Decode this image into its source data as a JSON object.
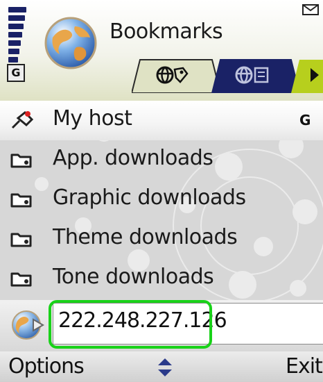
{
  "header": {
    "title": "Bookmarks",
    "gprs_indicator": "G",
    "signal_icon": "signal-strength-icon",
    "message_icon": "envelope-icon",
    "app_icon": "globe-icon",
    "tabs": [
      {
        "icon": "globe-bookmark-tab-icon",
        "active": true
      },
      {
        "icon": "globe-page-tab-icon",
        "active": false
      },
      {
        "icon": "next-arrow-icon",
        "active": false
      }
    ]
  },
  "bookmarks": [
    {
      "label": "My host",
      "icon": "pin-icon",
      "badge": "G",
      "selected": true
    },
    {
      "label": "App. downloads",
      "icon": "folder-icon",
      "selected": false
    },
    {
      "label": "Graphic downloads",
      "icon": "folder-icon",
      "selected": false
    },
    {
      "label": "Theme downloads",
      "icon": "folder-icon",
      "selected": false
    },
    {
      "label": "Tone downloads",
      "icon": "folder-icon",
      "selected": false
    }
  ],
  "address": {
    "value": "222.248.227.126",
    "icon": "globe-go-icon"
  },
  "softkeys": {
    "left": "Options",
    "middle_icon": "up-down-scroll-icon",
    "right": "Exit"
  },
  "colors": {
    "signal": "#1a2266",
    "highlight": "#19d219",
    "tab_active": "#dfe2c4",
    "tab_inactive": "#1a2266",
    "tab_next": "#b7cf1d"
  }
}
